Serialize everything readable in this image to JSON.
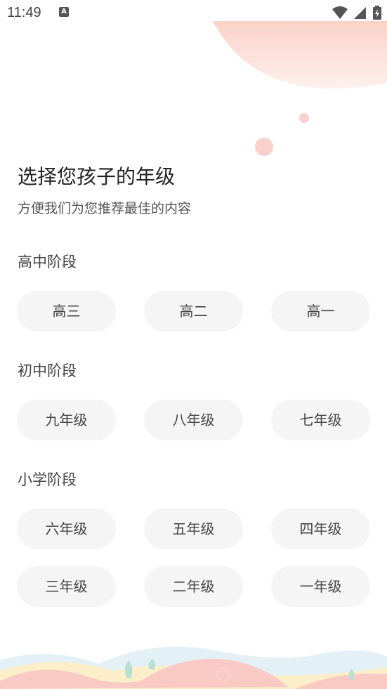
{
  "status_bar": {
    "time": "11:49",
    "notification_icon": "A",
    "icons": [
      "wifi-icon",
      "signal-icon",
      "battery-icon"
    ]
  },
  "header": {
    "title": "选择您孩子的年级",
    "subtitle": "方便我们为您推荐最佳的内容"
  },
  "sections": [
    {
      "label": "高中阶段",
      "grades": [
        "高三",
        "高二",
        "高一"
      ]
    },
    {
      "label": "初中阶段",
      "grades": [
        "九年级",
        "八年级",
        "七年级"
      ]
    },
    {
      "label": "小学阶段",
      "grades": [
        "六年级",
        "五年级",
        "四年级",
        "三年级",
        "二年级",
        "一年级"
      ]
    }
  ],
  "colors": {
    "accent_pink": "#fbd9d2",
    "button_bg": "#f5f5f5",
    "text_primary": "#222222",
    "text_secondary": "#555555"
  }
}
